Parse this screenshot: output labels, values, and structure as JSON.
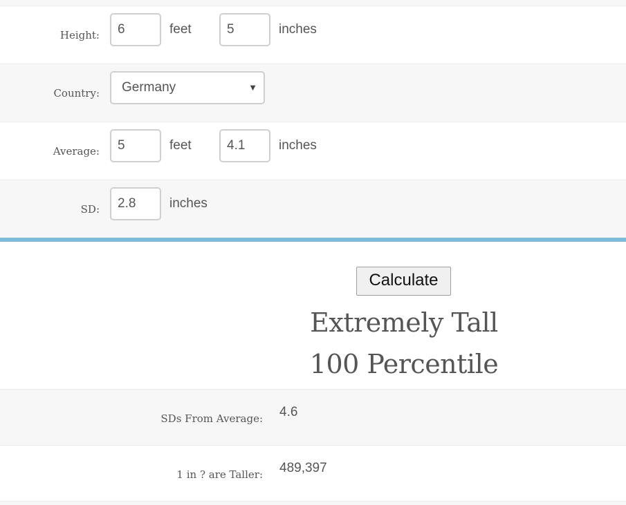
{
  "form": {
    "height": {
      "label": "Height:",
      "feet": "6",
      "feet_unit": "feet",
      "inches": "5",
      "inches_unit": "inches"
    },
    "country": {
      "label": "Country:",
      "selected": "Germany"
    },
    "average": {
      "label": "Average:",
      "feet": "5",
      "feet_unit": "feet",
      "inches": "4.1",
      "inches_unit": "inches"
    },
    "sd": {
      "label": "SD:",
      "value": "2.8",
      "unit": "inches"
    }
  },
  "actions": {
    "calculate_label": "Calculate"
  },
  "result": {
    "category": "Extremely Tall",
    "percentile": "100 Percentile",
    "sds_label": "SDs From Average:",
    "sds_value": "4.6",
    "taller_label": "1 in ? are Taller:",
    "taller_value": "489,397"
  },
  "colors": {
    "accent_bar": "#7dbbd9",
    "row_alt": "#f7f7f7",
    "text": "#555555"
  },
  "icons": {
    "select_arrow": "dropdown-arrow-icon"
  }
}
